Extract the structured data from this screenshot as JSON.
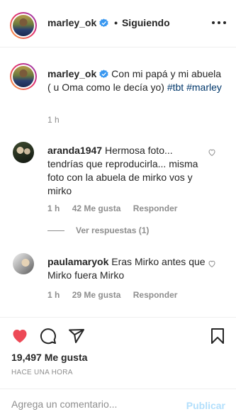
{
  "header": {
    "username": "marley_ok",
    "separator": "•",
    "following_label": "Siguiendo",
    "more_icon": "more-horizontal-icon"
  },
  "caption": {
    "username": "marley_ok",
    "text": "Con mi papá y mi abuela ( u Oma como le decía yo)",
    "hashtags": [
      "#tbt",
      "#marley"
    ],
    "time": "1 h"
  },
  "comments": [
    {
      "username": "aranda1947",
      "text": "Hermosa foto... tendrías que reproducirla... misma foto con la abuela de mirko vos y mirko",
      "time": "1 h",
      "likes": "42 Me gusta",
      "reply_label": "Responder",
      "view_replies": "Ver respuestas (1)"
    },
    {
      "username": "paulamaryok",
      "text": "Eras Mirko antes que Mirko fuera Mirko",
      "time": "1 h",
      "likes": "29 Me gusta",
      "reply_label": "Responder"
    }
  ],
  "actions": {
    "like_icon": "heart-filled-icon",
    "comment_icon": "comment-icon",
    "share_icon": "share-icon",
    "save_icon": "bookmark-icon",
    "like_color": "#ed4956"
  },
  "post": {
    "likes": "19,497 Me gusta",
    "posted": "HACE UNA HORA"
  },
  "add_comment": {
    "placeholder": "Agrega un comentario...",
    "publish_label": "Publicar",
    "publish_color": "#b2dffc"
  },
  "colors": {
    "verified": "#3897f0",
    "hashtag": "#00376b",
    "secondary_text": "#8e8e8e"
  }
}
